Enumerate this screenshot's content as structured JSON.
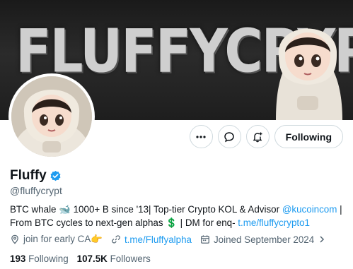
{
  "banner": {
    "text": "FLUFFYCRYPT"
  },
  "actions": {
    "more_label": "More",
    "message_label": "Message",
    "notify_label": "Notifications",
    "following_label": "Following"
  },
  "profile": {
    "name": "Fluffy",
    "handle": "@fluffycrypt"
  },
  "bio": {
    "line1_part1": "BTC whale 🐋 1000+ B since '13| Top-tier Crypto KOL & Advisor ",
    "line1_link": "@kucoincom",
    "line1_part2": " |",
    "line2_part1": "From BTC cycles to next-gen alphas 💲 | DM for enq- ",
    "line2_link": "t.me/fluffycrypto1"
  },
  "meta": {
    "location": "join for early CA👉",
    "website": "t.me/Fluffyalpha",
    "joined": "Joined September 2024"
  },
  "stats": {
    "following_count": "193",
    "following_label": "Following",
    "followers_count": "107.5K",
    "followers_label": "Followers"
  },
  "colors": {
    "accent": "#1d9bf0",
    "muted": "#536471",
    "text": "#0f1419",
    "verified": "#1d9bf0"
  },
  "icons": [
    "more-icon",
    "message-icon",
    "notify-plus-icon",
    "verified-icon",
    "location-icon",
    "link-icon",
    "calendar-icon",
    "chevron-right-icon"
  ]
}
